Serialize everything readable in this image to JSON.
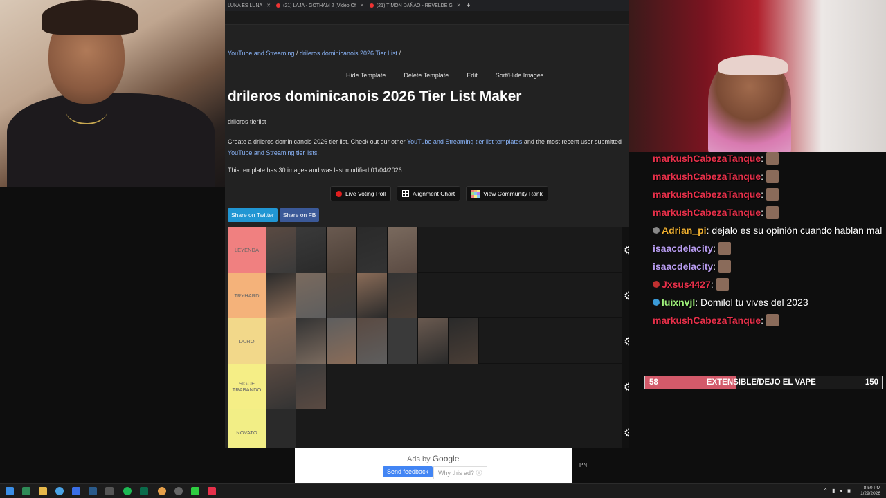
{
  "browser": {
    "tabs": [
      {
        "title": "LUNA ES LUNA"
      },
      {
        "title": "(21) LAJA - GOTHAM 2 (Video Of"
      },
      {
        "title": "(21) TIMON DAÑAO - REVELDE G"
      }
    ],
    "new_tab": "+"
  },
  "breadcrumb": {
    "category": "YouTube and Streaming",
    "sep1": " / ",
    "template": "drileros dominicanois 2026 Tier List",
    "sep2": " /"
  },
  "template_actions": [
    "Hide Template",
    "Delete Template",
    "Edit",
    "Sort/Hide Images"
  ],
  "page_title": "drileros dominicanois 2026 Tier List Maker",
  "subtitle": "drileros tierlist",
  "description": {
    "prefix": "Create a drileros dominicanois 2026 tier list. Check out our other ",
    "link1": "YouTube and Streaming tier list templates",
    "middle": " and the most recent user submitted ",
    "link2": "YouTube and Streaming tier lists",
    "suffix": "."
  },
  "meta": "This template has 30 images and was last modified 01/04/2026.",
  "tools": {
    "live_voting": "Live Voting Poll",
    "alignment": "Alignment Chart",
    "community": "View Community Rank"
  },
  "share": {
    "twitter": "Share on Twitter",
    "facebook": "Share on FB"
  },
  "tiers": [
    {
      "label": "LEYENDA",
      "color": "#f08080",
      "count": 5
    },
    {
      "label": "TRYHARD",
      "color": "#f4b27a",
      "count": 5
    },
    {
      "label": "DURO",
      "color": "#f2d88a",
      "count": 7
    },
    {
      "label": "SIGUE TRABANDO",
      "color": "#f5ee86",
      "count": 2
    },
    {
      "label": "NOVATO",
      "color": "#f2ee86",
      "count": 1
    }
  ],
  "chat": [
    {
      "user": "markushCabezaTanque",
      "text": " :",
      "color": "#e8304a",
      "emote": true
    },
    {
      "user": "markushCabezaTanque",
      "text": " :",
      "color": "#e8304a",
      "emote": true
    },
    {
      "user": "markushCabezaTanque",
      "text": " :",
      "color": "#e8304a",
      "emote": true
    },
    {
      "user": "markushCabezaTanque",
      "text": " :",
      "color": "#e8304a",
      "emote": true
    },
    {
      "user": "Adrian_pi",
      "text": " : dejalo es su opinión cuando hablan mal",
      "color": "#f0b030",
      "emote": false,
      "badge": "#888"
    },
    {
      "user": "isaacdelacity",
      "text": " :",
      "color": "#b89cf0",
      "emote": true
    },
    {
      "user": "isaacdelacity",
      "text": " :",
      "color": "#b89cf0",
      "emote": true
    },
    {
      "user": "Jxsus4427",
      "text": " :",
      "color": "#e8304a",
      "emote": true,
      "badge": "#c03030"
    },
    {
      "user": "luixnvjl",
      "text": " : Domilol tu vives del 2023",
      "color": "#9ef07a",
      "emote": false,
      "badge": "#3a9ad8"
    },
    {
      "user": "markushCabezaTanque",
      "text": " :",
      "color": "#e8304a",
      "emote": true
    }
  ],
  "goal": {
    "current": "58",
    "label": "EXTENSIBLE/DEJO EL VAPE",
    "target": "150",
    "progress": 0.3867,
    "fill_color": "#d35a6a"
  },
  "ad": {
    "ads_by": "Ads by",
    "google": "Google",
    "feedback": "Send feedback",
    "why": "Why this ad? ⓘ"
  },
  "pn": "PN",
  "clock": {
    "time": "8:50 PM",
    "date": "1/29/2026"
  }
}
